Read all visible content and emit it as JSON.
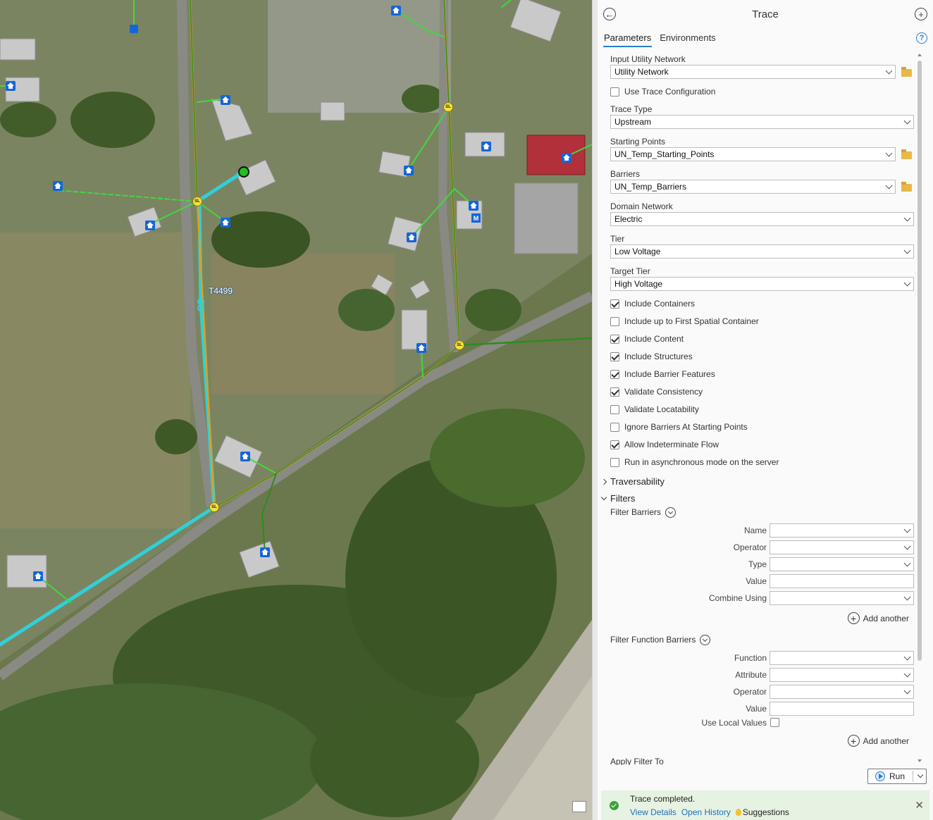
{
  "pane": {
    "title": "Trace",
    "back_icon": "arrow-left-circle-icon",
    "add_icon": "plus-circle-icon",
    "tabs": [
      {
        "label": "Parameters",
        "active": true
      },
      {
        "label": "Environments",
        "active": false
      }
    ],
    "help_icon": "question-icon"
  },
  "params": {
    "input_utility_network": {
      "label": "Input Utility Network",
      "value": "Utility Network"
    },
    "use_trace_configuration": {
      "label": "Use Trace Configuration",
      "checked": false
    },
    "trace_type": {
      "label": "Trace Type",
      "value": "Upstream"
    },
    "starting_points": {
      "label": "Starting Points",
      "value": "UN_Temp_Starting_Points"
    },
    "barriers": {
      "label": "Barriers",
      "value": "UN_Temp_Barriers"
    },
    "domain_network": {
      "label": "Domain Network",
      "value": "Electric"
    },
    "tier": {
      "label": "Tier",
      "value": "Low Voltage"
    },
    "target_tier": {
      "label": "Target Tier",
      "value": "High Voltage"
    },
    "checkboxes": [
      {
        "label": "Include Containers",
        "checked": true
      },
      {
        "label": "Include up to First Spatial Container",
        "checked": false
      },
      {
        "label": "Include Content",
        "checked": true
      },
      {
        "label": "Include Structures",
        "checked": true
      },
      {
        "label": "Include Barrier Features",
        "checked": true
      },
      {
        "label": "Validate Consistency",
        "checked": true
      },
      {
        "label": "Validate Locatability",
        "checked": false
      },
      {
        "label": "Ignore Barriers At Starting Points",
        "checked": false
      },
      {
        "label": "Allow Indeterminate Flow",
        "checked": true
      },
      {
        "label": "Run in asynchronous mode on the server",
        "checked": false
      }
    ]
  },
  "sections": {
    "traversability": "Traversability",
    "filters": "Filters",
    "filter_barriers": "Filter Barriers",
    "filter_function_barriers": "Filter Function Barriers",
    "apply_filter_to": "Apply Filter To"
  },
  "filter_barriers_fields": [
    "Name",
    "Operator",
    "Type",
    "Value",
    "Combine Using"
  ],
  "filter_function_fields": [
    "Function",
    "Attribute",
    "Operator",
    "Value"
  ],
  "use_local_values": "Use Local Values",
  "add_another": "Add another",
  "run_label": "Run",
  "status": {
    "message": "Trace completed.",
    "view_details": "View Details",
    "open_history": "Open History",
    "suggestions": "Suggestions"
  },
  "map": {
    "label_feature": "T4499",
    "symbol_marker": "SL",
    "meter_marker": "M"
  },
  "colors": {
    "accent": "#2a7fc9",
    "trace_cyan": "#2fd0d8",
    "line_green": "#3fd93f",
    "line_dark_green": "#2e8b1f",
    "line_orange": "#e0a020",
    "status_bg": "#e6f2e2"
  }
}
